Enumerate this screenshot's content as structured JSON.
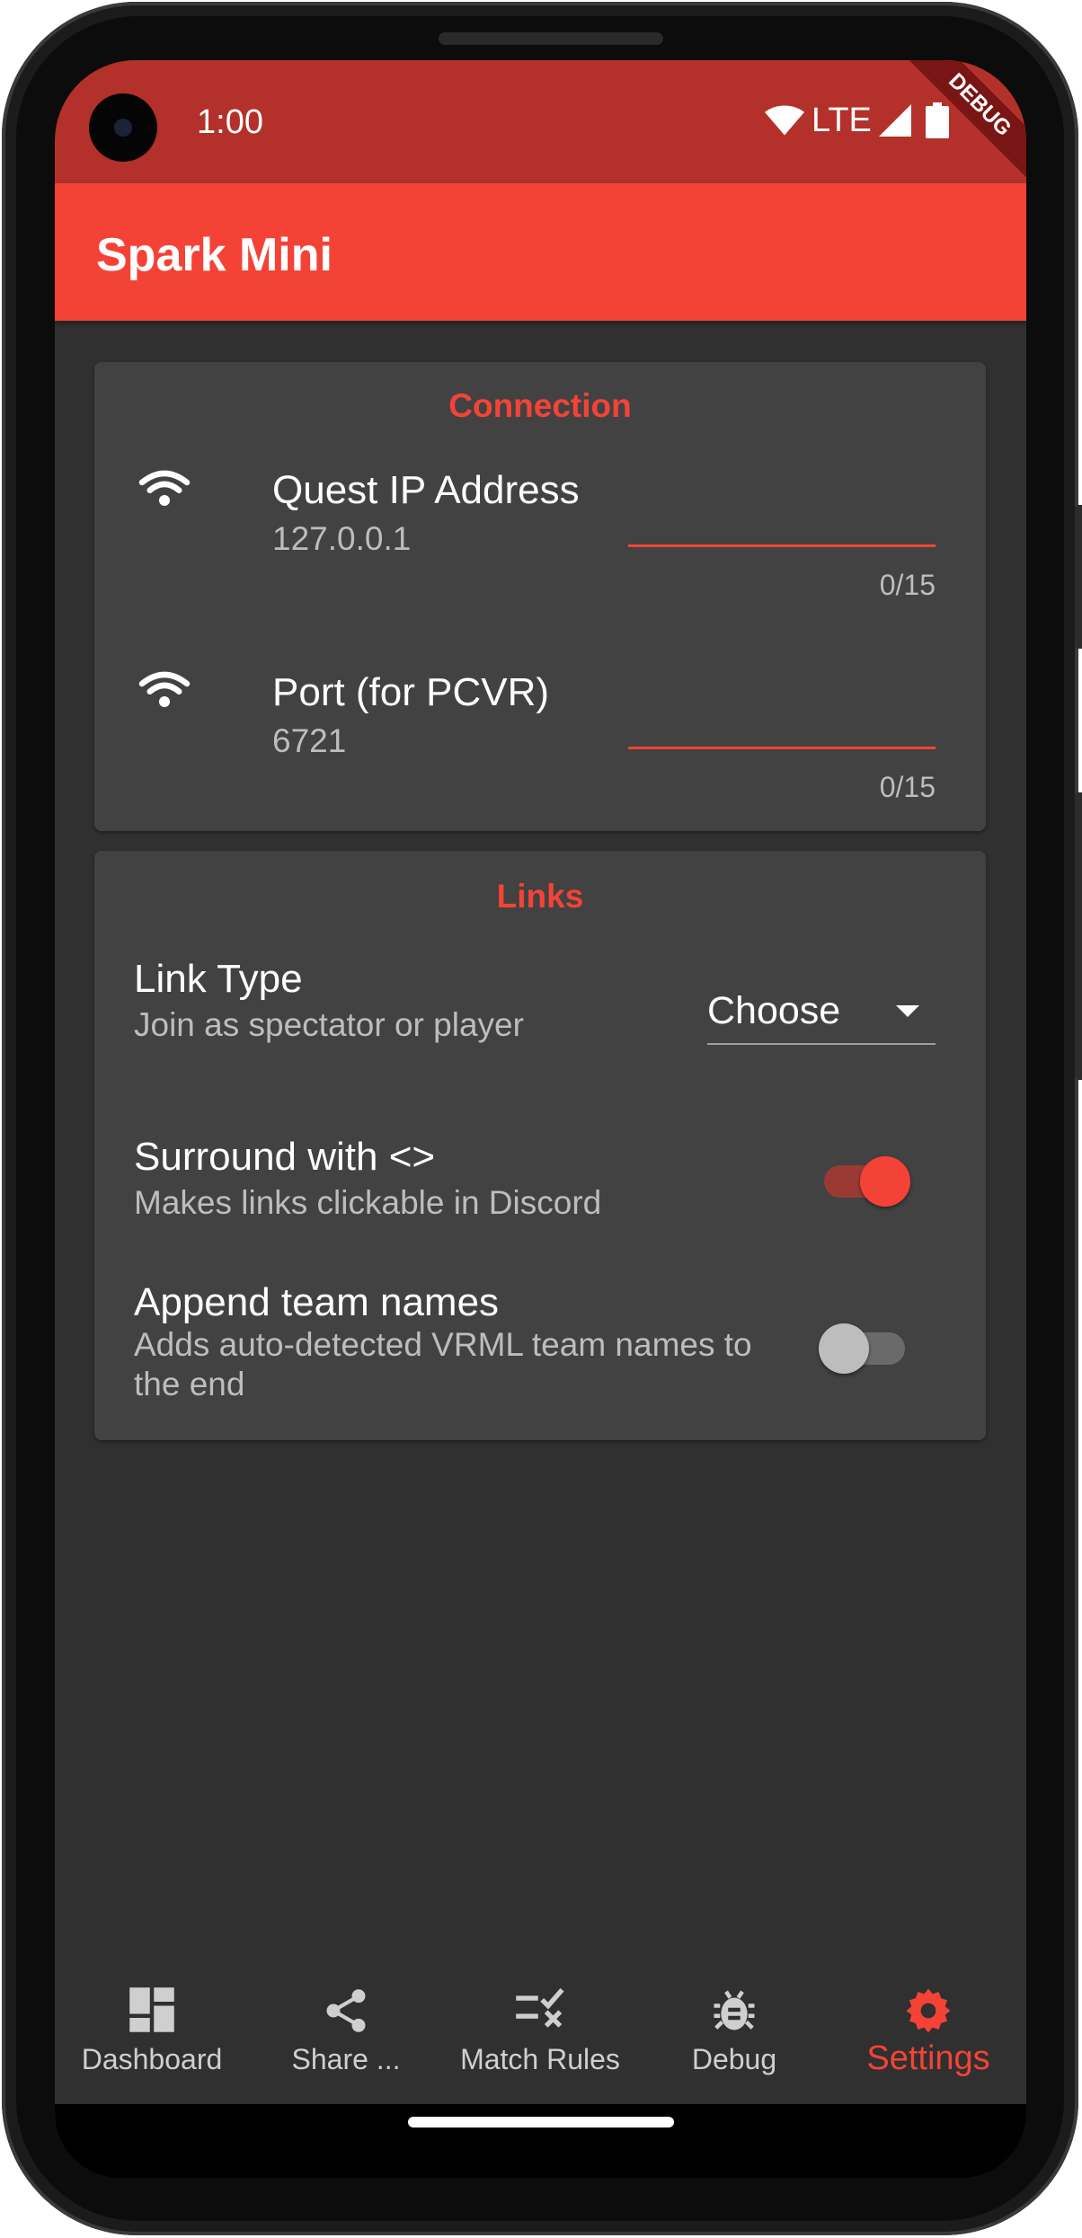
{
  "status_bar": {
    "time": "1:00",
    "network": "LTE",
    "debug_banner": "DEBUG"
  },
  "app_bar": {
    "title": "Spark Mini"
  },
  "connection": {
    "title": "Connection",
    "fields": [
      {
        "label": "Quest IP Address",
        "value": "127.0.0.1",
        "counter": "0/15",
        "icon": "wifi-icon"
      },
      {
        "label": "Port (for PCVR)",
        "value": "6721",
        "counter": "0/15",
        "icon": "wifi-icon"
      }
    ]
  },
  "links": {
    "title": "Links",
    "link_type": {
      "title": "Link Type",
      "subtitle": "Join as spectator or player",
      "dropdown_value": "Choose"
    },
    "surround": {
      "title": "Surround with <>",
      "subtitle": "Makes links clickable in Discord",
      "enabled": true
    },
    "append_team": {
      "title": "Append team names",
      "subtitle": "Adds auto-detected VRML team names to the end",
      "enabled": false
    }
  },
  "bottom_nav": {
    "items": [
      {
        "label": "Dashboard",
        "icon": "dashboard-icon",
        "active": false
      },
      {
        "label": "Share ...",
        "icon": "share-icon",
        "active": false
      },
      {
        "label": "Match Rules",
        "icon": "rule-icon",
        "active": false
      },
      {
        "label": "Debug",
        "icon": "bug-icon",
        "active": false
      },
      {
        "label": "Settings",
        "icon": "gear-icon",
        "active": true
      }
    ]
  },
  "colors": {
    "accent": "#f44336",
    "status_bar": "#b3312a",
    "background": "#303030",
    "card": "#424242"
  }
}
